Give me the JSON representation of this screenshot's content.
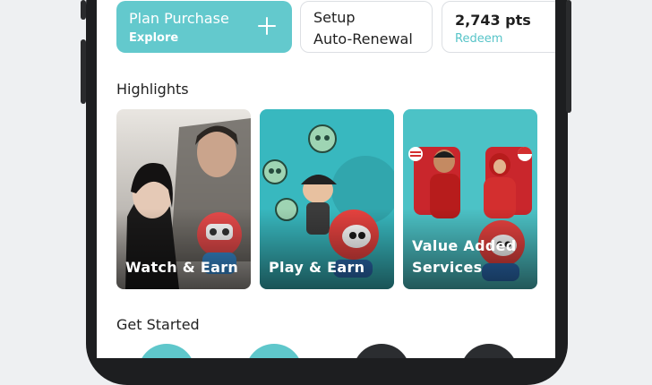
{
  "quick_actions": {
    "plan": {
      "title": "Plan Purchase",
      "subtitle": "Explore",
      "icon": "plus-icon"
    },
    "auto_renewal": {
      "line1": "Setup",
      "line2": "Auto-Renewal"
    },
    "points": {
      "value": "2,743 pts",
      "action": "Redeem"
    }
  },
  "highlights": {
    "title": "Highlights",
    "cards": [
      {
        "label": "Watch & Earn"
      },
      {
        "label": "Play & Earn"
      },
      {
        "label": "Value Added Services"
      }
    ]
  },
  "get_started": {
    "title": "Get Started"
  },
  "colors": {
    "accent": "#63c9cd",
    "link": "#57c4c8",
    "frame": "#1d1e20"
  }
}
